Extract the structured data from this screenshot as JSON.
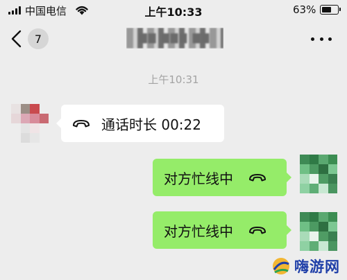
{
  "status_bar": {
    "carrier": "中国电信",
    "time": "上午10:33",
    "battery_percent": "63%",
    "battery_level": 0.63
  },
  "nav": {
    "back_badge": "7",
    "contact_name": "▇▇ ▇▇▇ ▇▇"
  },
  "chat": {
    "timestamp": "上午10:31",
    "messages": [
      {
        "direction": "incoming",
        "type": "call",
        "text": "通话时长 00:22",
        "icon": "phone-hangup-icon"
      },
      {
        "direction": "outgoing",
        "type": "call",
        "text": "对方忙线中",
        "icon": "phone-hangup-icon"
      },
      {
        "direction": "outgoing",
        "type": "call",
        "text": "对方忙线中",
        "icon": "phone-hangup-icon"
      }
    ]
  },
  "watermark": {
    "text": "嗨游网"
  },
  "colors": {
    "background": "#ededed",
    "outgoing_bubble": "#95ec69",
    "incoming_bubble": "#ffffff",
    "timestamp": "#a3a3a3"
  }
}
